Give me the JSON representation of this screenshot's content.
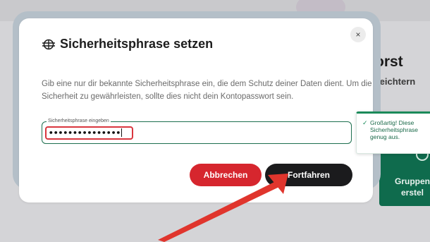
{
  "background": {
    "heading_fragment": "orst",
    "subheading_fragment": "rleichtern",
    "card_label": "Gruppen erstel"
  },
  "dialog": {
    "title": "Sicherheitsphrase setzen",
    "title_icon": "dollar-with-lines-icon",
    "close_symbol": "×",
    "description": "Gib eine nur dir bekannte Sicherheitsphrase ein, die dem Schutz deiner Daten dient. Um die Sicherheit zu gewährleisten, sollte dies nicht dein Kontopasswort sein.",
    "input": {
      "label": "Sicherheitsphrase eingeben",
      "value": "•••••••••••••••"
    },
    "cancel_label": "Abbrechen",
    "continue_label": "Fortfahren"
  },
  "toast": {
    "check_symbol": "✓",
    "message": "Großartig! Diese Sicherheitsphrase genug aus."
  },
  "colors": {
    "accent_green": "#1d6f4f",
    "cancel_red": "#d6262e",
    "primary_dark": "#1b1b1d",
    "annotation_red": "#e0352d"
  }
}
